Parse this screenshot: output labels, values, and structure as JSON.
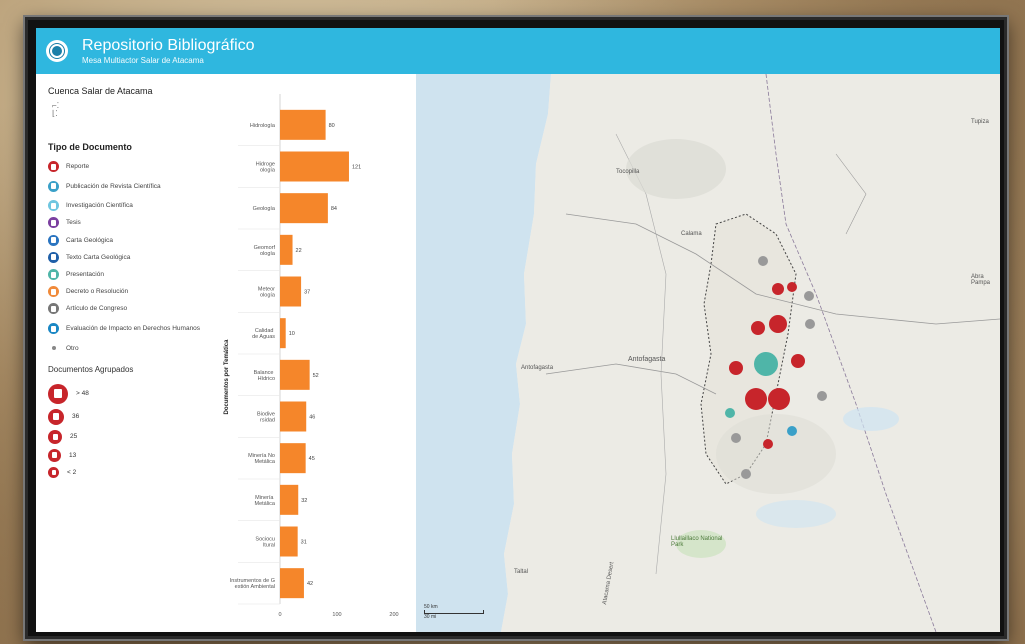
{
  "header": {
    "title": "Repositorio Bibliográfico",
    "subtitle": "Mesa Multiactor Salar de Atacama"
  },
  "left_panel": {
    "basin_title": "Cuenca Salar de Atacama",
    "doc_type_title": "Tipo de Documento",
    "doc_types": [
      {
        "label": "Reporte",
        "color": "#c7252b"
      },
      {
        "label": "Publicación de Revista Científica",
        "color": "#3aa0c8"
      },
      {
        "label": "Investigación Científica",
        "color": "#6fc6e0"
      },
      {
        "label": "Tesis",
        "color": "#7b3fa0"
      },
      {
        "label": "Carta Geológica",
        "color": "#2a74c0"
      },
      {
        "label": "Texto Carta Geológica",
        "color": "#1f5fa8"
      },
      {
        "label": "Presentación",
        "color": "#4fb5a8"
      },
      {
        "label": "Decreto o Resolución",
        "color": "#f08a3a"
      },
      {
        "label": "Artículo de Congreso",
        "color": "#777777"
      },
      {
        "label": "Evaluación de Impacto en Derechos Humanos",
        "color": "#1a87c4"
      },
      {
        "label": "Otro",
        "color": "#888888"
      }
    ],
    "grouped_title": "Documentos Agrupados",
    "grouped": [
      {
        "label": "> 48"
      },
      {
        "label": "36"
      },
      {
        "label": "25"
      },
      {
        "label": "13"
      },
      {
        "label": "< 2"
      }
    ]
  },
  "chart_data": {
    "type": "bar",
    "orientation": "horizontal",
    "title": "",
    "ylabel": "Documentos por Temática",
    "xlabel": "",
    "xlim": [
      0,
      200
    ],
    "xticks": [
      "0",
      "100",
      "200"
    ],
    "categories": [
      "Hidrología",
      "Hidrogeología",
      "Geología",
      "Geomorfología",
      "Meteorología",
      "Calidad de Aguas",
      "Balance Hídrico",
      "Biodiversidad",
      "Minería No Metálica",
      "Minería Metálica",
      "Sociocultural",
      "Instrumentos de Gestión Ambiental"
    ],
    "values": [
      80,
      121,
      84,
      22,
      37,
      10,
      52,
      46,
      45,
      32,
      31,
      42
    ],
    "bar_color": "#f5862a"
  },
  "map": {
    "labels": {
      "tocopilla": "Tocopilla",
      "calama": "Calama",
      "antofagasta_city": "Antofagasta",
      "antofagasta_region": "Antofagasta",
      "taltal": "Taltal",
      "national_park": "Llullaillaco National Park",
      "desert": "Atacama Desert",
      "right_top": "Tupiza",
      "right_mid": "Abra Pampa"
    },
    "scale": {
      "km": "50 km",
      "mi": "30 mi"
    },
    "cluster_color": "#c7252b"
  }
}
